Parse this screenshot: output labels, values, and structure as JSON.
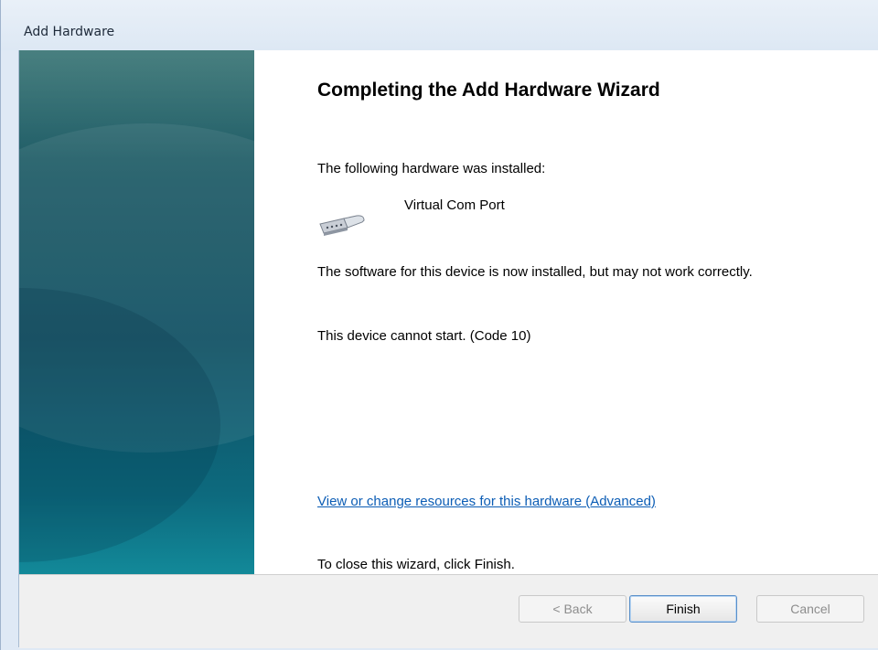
{
  "window": {
    "title": "Add Hardware"
  },
  "wizard": {
    "heading": "Completing the Add Hardware Wizard",
    "installed_label": "The following hardware was installed:",
    "device_name": "Virtual Com Port",
    "device_icon": "serial-port-connector-icon",
    "software_message": "The software for this device is now installed, but may not work correctly.",
    "status_message": "This device cannot start. (Code 10)",
    "advanced_link": "View or change resources for this hardware (Advanced)",
    "close_instruction": "To close this wizard, click Finish."
  },
  "buttons": {
    "back": "< Back",
    "finish": "Finish",
    "cancel": "Cancel"
  },
  "colors": {
    "link": "#0c5db5",
    "banner": "#0f4f62"
  }
}
